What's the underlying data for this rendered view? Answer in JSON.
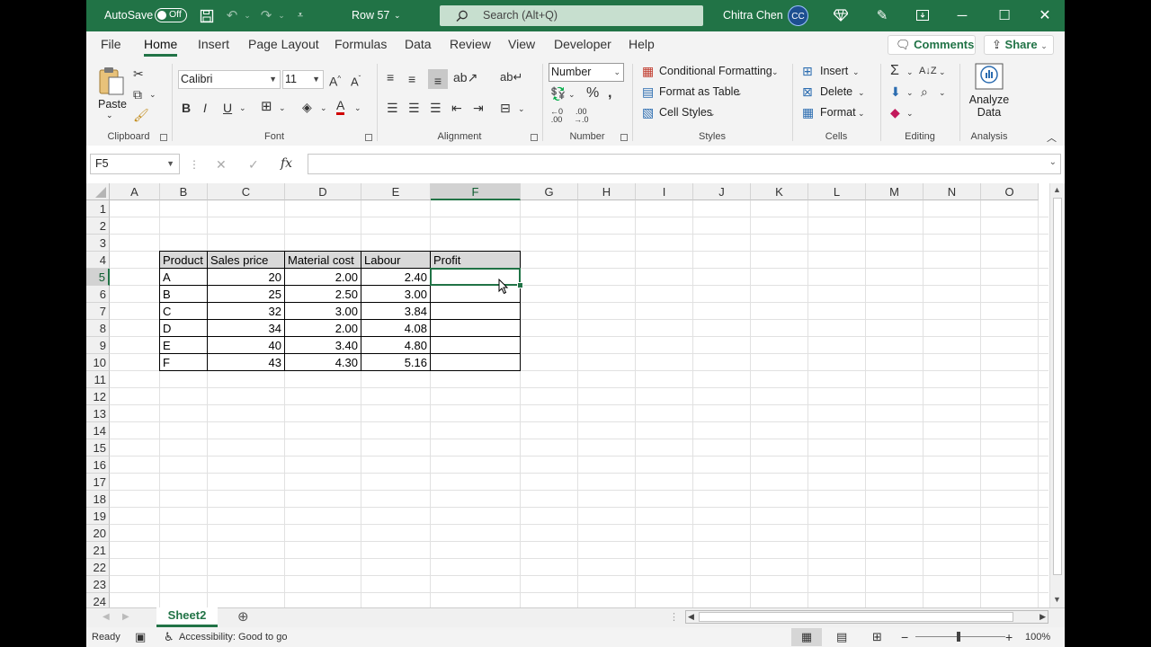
{
  "titlebar": {
    "autosave_label": "AutoSave",
    "autosave_state": "Off",
    "doc_title": "Row 57",
    "search_placeholder": "Search (Alt+Q)",
    "user_name": "Chitra Chen",
    "user_initials": "CC"
  },
  "tabs": {
    "items": [
      "File",
      "Home",
      "Insert",
      "Page Layout",
      "Formulas",
      "Data",
      "Review",
      "View",
      "Developer",
      "Help"
    ],
    "active": "Home",
    "comments_label": "Comments",
    "share_label": "Share"
  },
  "ribbon": {
    "clipboard": {
      "paste_label": "Paste",
      "group_label": "Clipboard"
    },
    "font": {
      "font_name": "Calibri",
      "font_size": "11",
      "group_label": "Font"
    },
    "alignment": {
      "group_label": "Alignment"
    },
    "number": {
      "format": "Number",
      "group_label": "Number"
    },
    "styles": {
      "conditional_formatting": "Conditional Formatting",
      "format_as_table": "Format as Table",
      "cell_styles": "Cell Styles",
      "group_label": "Styles"
    },
    "cells": {
      "insert": "Insert",
      "delete": "Delete",
      "format": "Format",
      "group_label": "Cells"
    },
    "editing": {
      "group_label": "Editing"
    },
    "analysis": {
      "analyze_line1": "Analyze",
      "analyze_line2": "Data",
      "group_label": "Analysis"
    }
  },
  "formula_bar": {
    "name_box": "F5",
    "fx_label": "fx",
    "formula": ""
  },
  "grid": {
    "columns": [
      "A",
      "B",
      "C",
      "D",
      "E",
      "F",
      "G",
      "H",
      "I",
      "J",
      "K",
      "L",
      "M",
      "N",
      "O"
    ],
    "rows": [
      "1",
      "2",
      "3",
      "4",
      "5",
      "6",
      "7",
      "8",
      "9",
      "10",
      "11",
      "12",
      "13",
      "14",
      "15",
      "16",
      "17",
      "18",
      "19",
      "20",
      "21",
      "22",
      "23",
      "24"
    ]
  },
  "table": {
    "headers": [
      "Product",
      "Sales price",
      "Material cost",
      "Labour",
      "Profit"
    ],
    "rows": [
      [
        "A",
        "20",
        "2.00",
        "2.40",
        ""
      ],
      [
        "B",
        "25",
        "2.50",
        "3.00",
        ""
      ],
      [
        "C",
        "32",
        "3.00",
        "3.84",
        ""
      ],
      [
        "D",
        "34",
        "2.00",
        "4.08",
        ""
      ],
      [
        "E",
        "40",
        "3.40",
        "4.80",
        ""
      ],
      [
        "F",
        "43",
        "4.30",
        "5.16",
        ""
      ]
    ]
  },
  "sheets": {
    "active": "Sheet2"
  },
  "status": {
    "ready": "Ready",
    "accessibility": "Accessibility: Good to go",
    "zoom": "100%"
  },
  "colors": {
    "brand": "#217346",
    "header_fill": "#d9d9d9"
  }
}
